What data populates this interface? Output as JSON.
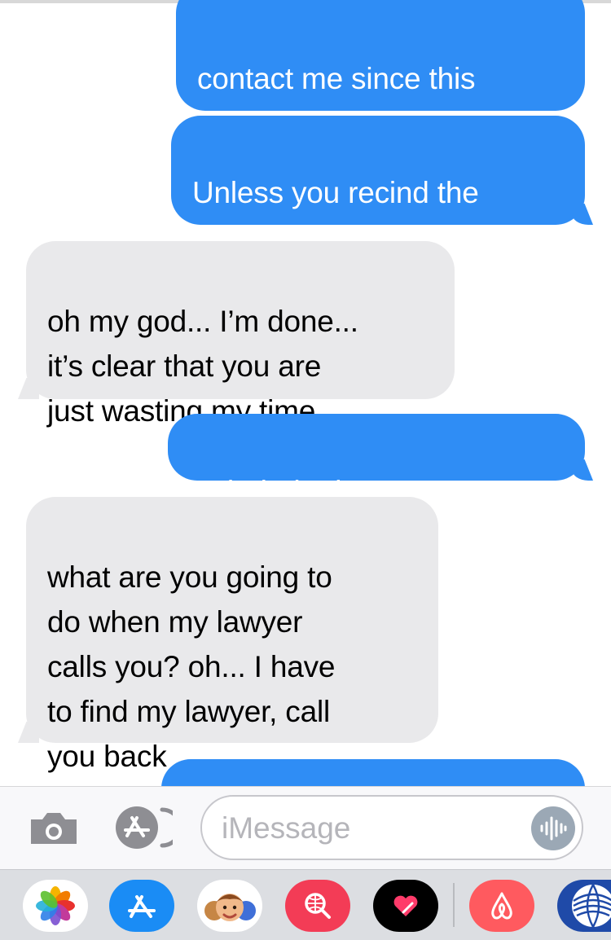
{
  "messages": [
    {
      "id": "m1",
      "side": "out",
      "text": "contact me since this\nwas your deal"
    },
    {
      "id": "m2",
      "side": "out",
      "text": "Unless you recind the\ndeal you can initiate"
    },
    {
      "id": "m3",
      "side": "in",
      "text": "oh my god... I’m done...\nit’s clear that you are\njust wasting my time."
    },
    {
      "id": "m4",
      "side": "out",
      "text": "Hahahah nice cop out"
    },
    {
      "id": "m5",
      "side": "in",
      "text": "what are you going to\ndo when my lawyer\ncalls you? oh... I have\nto find my lawyer, call\nyou back"
    },
    {
      "id": "m6",
      "side": "out",
      "text": ""
    }
  ],
  "composer": {
    "placeholder": "iMessage",
    "camera_icon": "camera-icon",
    "apps_icon": "app-store-icon",
    "audio_icon": "audio-waveform-icon"
  },
  "app_drawer": [
    {
      "name": "photos-app-icon"
    },
    {
      "name": "app-store-app-icon"
    },
    {
      "name": "memoji-app-icon"
    },
    {
      "name": "images-search-app-icon"
    },
    {
      "name": "digital-touch-app-icon"
    },
    {
      "name": "airbnb-app-icon"
    },
    {
      "name": "united-airlines-app-icon"
    }
  ],
  "colors": {
    "outgoing": "#2f8df5",
    "incoming": "#e9e9eb"
  }
}
